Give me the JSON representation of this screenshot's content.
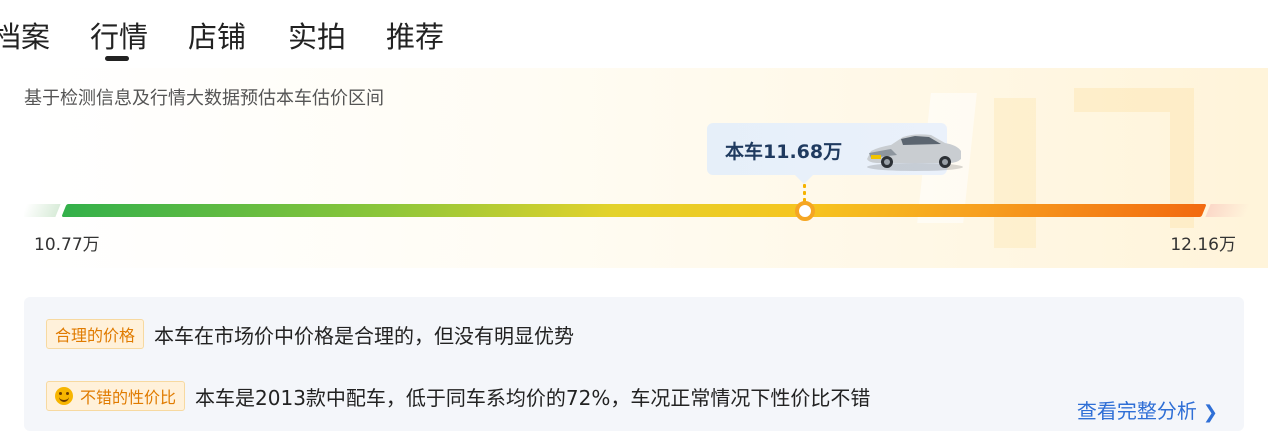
{
  "tabs": [
    {
      "label": "档案"
    },
    {
      "label": "行情",
      "active": true
    },
    {
      "label": "店铺"
    },
    {
      "label": "实拍"
    },
    {
      "label": "推荐"
    }
  ],
  "estimate": {
    "subtitle": "基于检测信息及行情大数据预估本车估价区间",
    "car_price_label": "本车11.68万",
    "min_price": "10.77万",
    "max_price": "12.16万",
    "car_position_fraction": 0.65
  },
  "analysis": {
    "rows": [
      {
        "tag": "合理的价格",
        "tag_icon": null,
        "text": "本车在市场价中价格是合理的，但没有明显优势"
      },
      {
        "tag": "不错的性价比",
        "tag_icon": "smile-icon",
        "text": "本车是2013款中配车，低于同车系均价的72%，车况正常情况下性价比不错"
      }
    ],
    "link_label": "查看完整分析",
    "link_icon": "chevron-right-icon"
  },
  "colors": {
    "bar_start": "#33b04a",
    "bar_mid": "#f6c51f",
    "bar_end": "#f26a10",
    "marker": "#f5a623",
    "tag_bg": "#fff1da",
    "tag_text": "#e07b00",
    "link": "#2f6fd6"
  }
}
